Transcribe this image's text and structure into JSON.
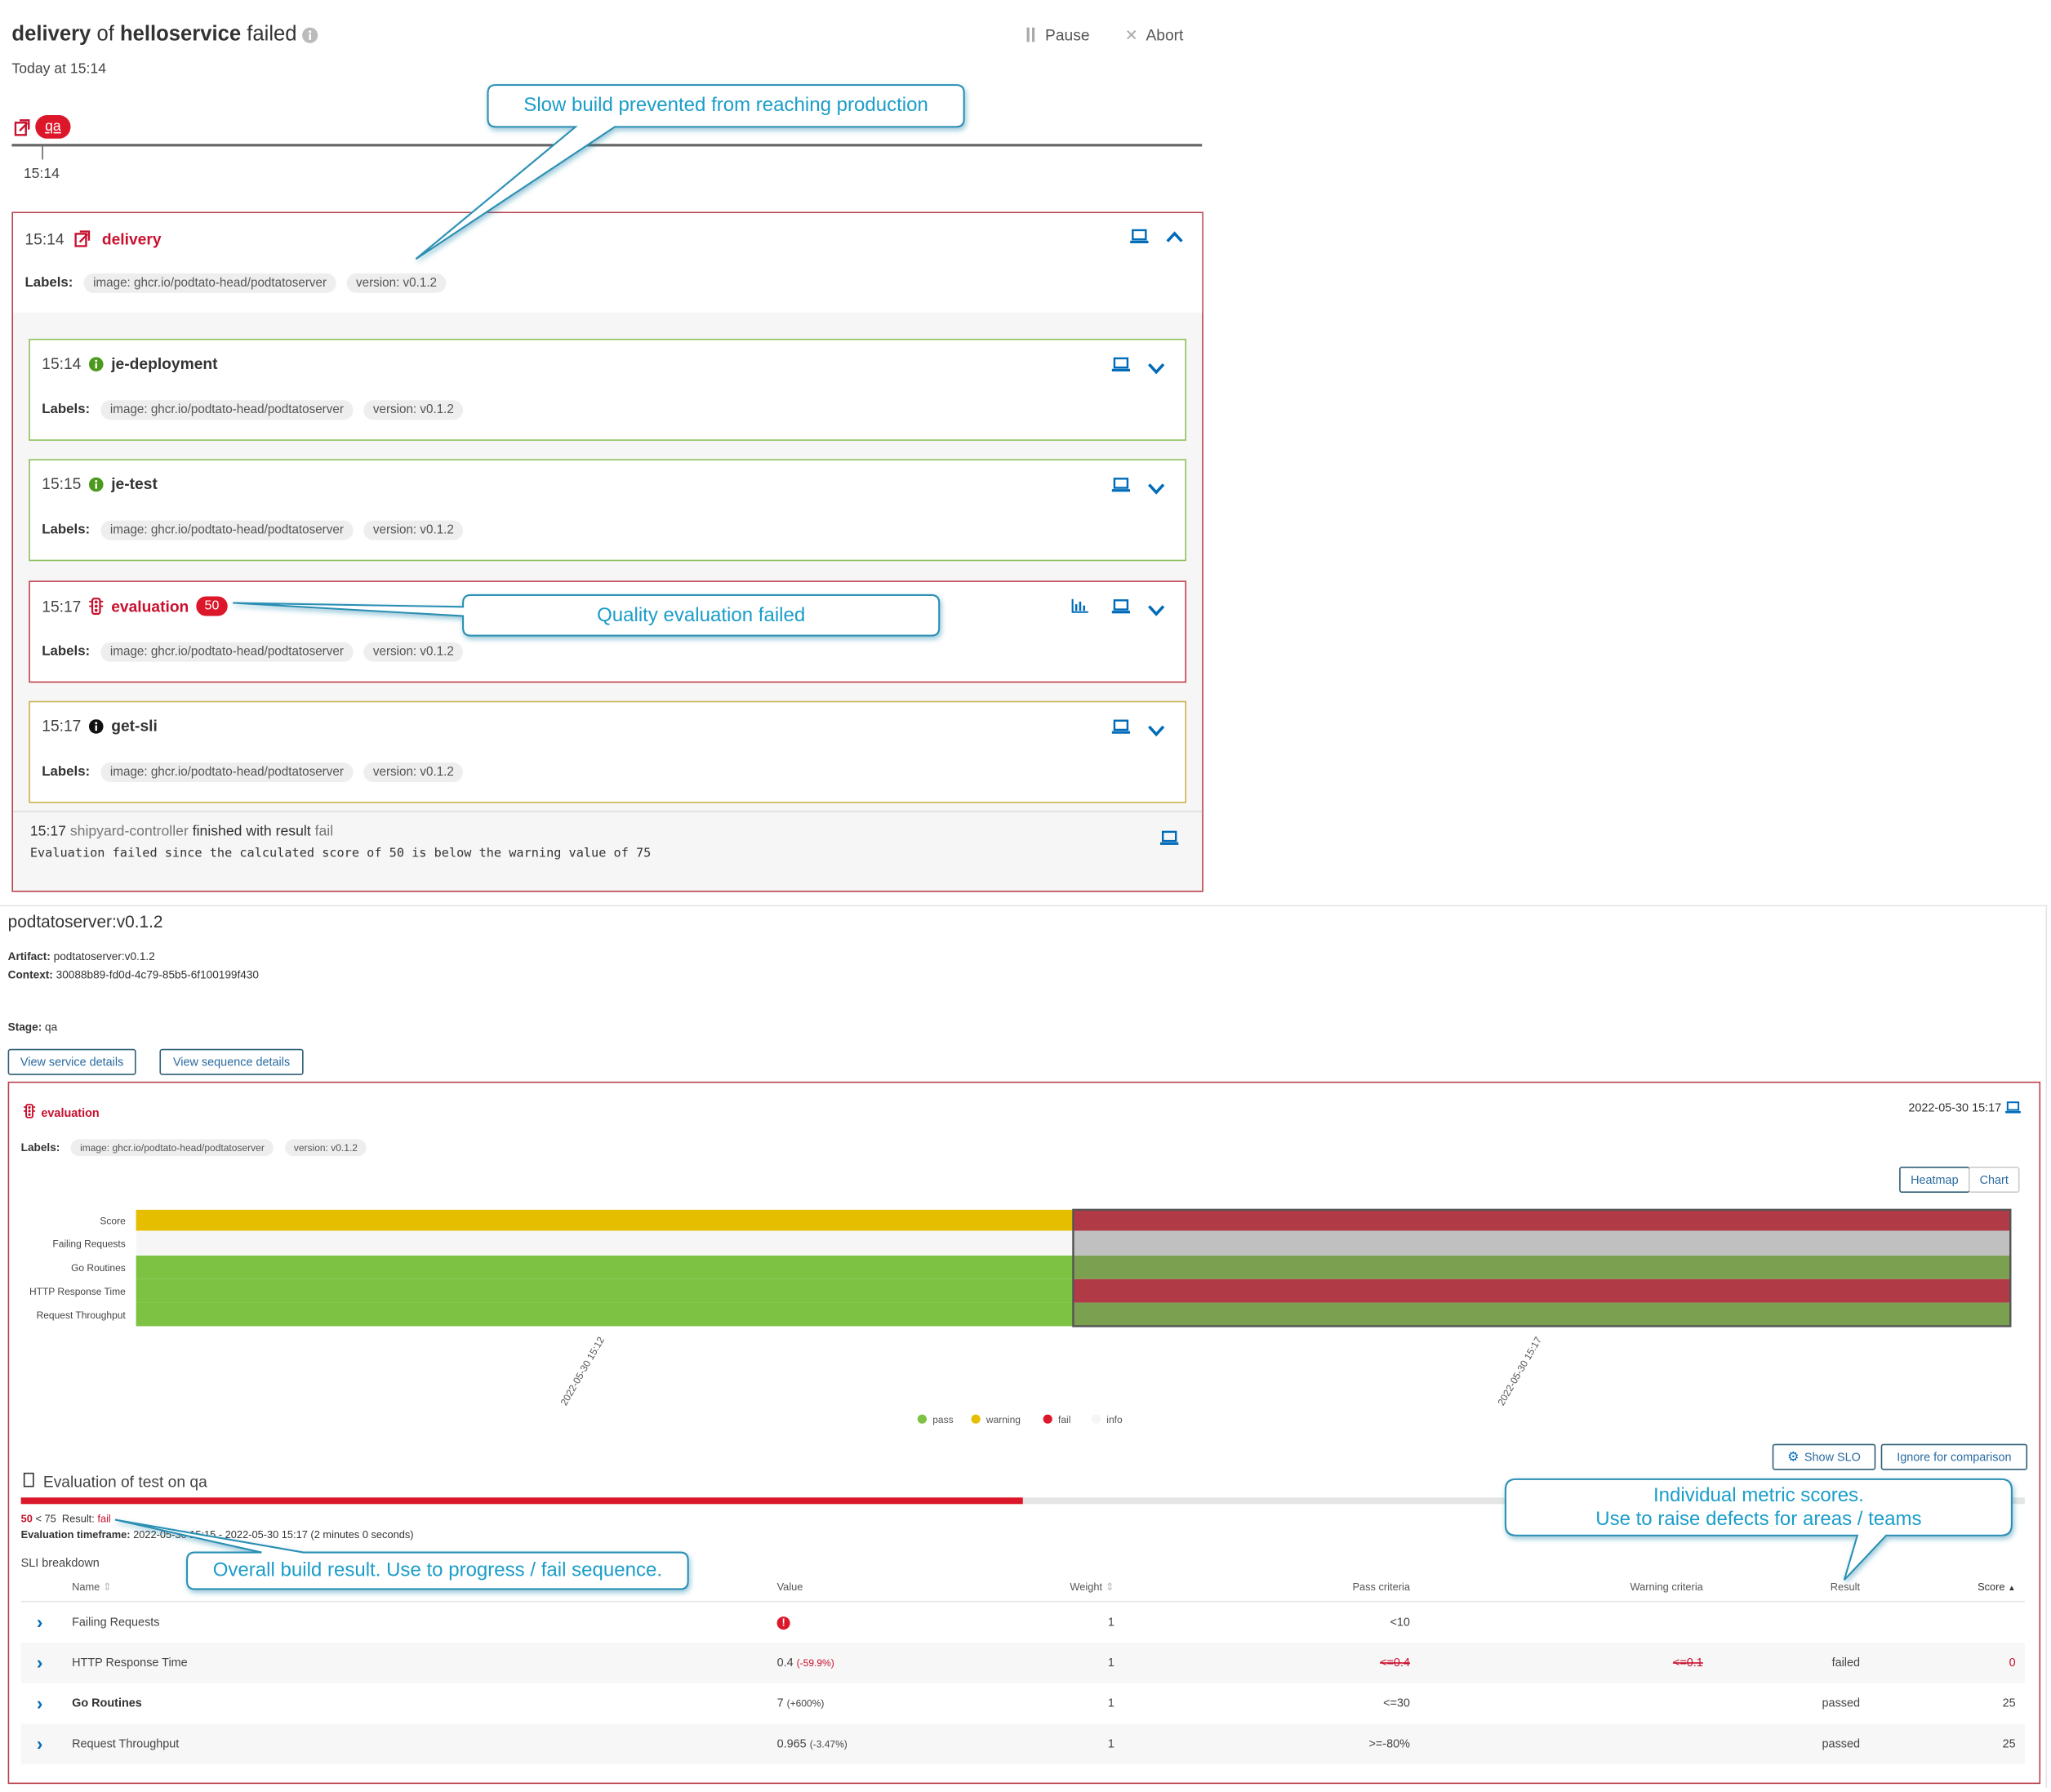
{
  "header": {
    "title_sequence": "delivery",
    "title_of": "of",
    "title_service": "helloservice",
    "title_status": "failed",
    "subtitle": "Today at 15:14",
    "pause_label": "Pause",
    "abort_label": "Abort"
  },
  "timeline": {
    "stage_badge": "qa",
    "tick_time": "15:14"
  },
  "delivery_card": {
    "time": "15:14",
    "name": "delivery",
    "labels_label": "Labels:",
    "labels": [
      "image: ghcr.io/podtato-head/podtatoserver",
      "version: v0.1.2"
    ],
    "tasks": [
      {
        "time": "15:14",
        "name": "je-deployment",
        "status": "success",
        "border": "#8dbf5a"
      },
      {
        "time": "15:15",
        "name": "je-test",
        "status": "success",
        "border": "#8dbf5a"
      },
      {
        "time": "15:17",
        "name": "evaluation",
        "status": "fail",
        "score": "50",
        "border": "#c2404c"
      },
      {
        "time": "15:17",
        "name": "get-sli",
        "status": "info",
        "border": "#c9b14a"
      }
    ],
    "footer": {
      "time": "15:17",
      "source": "shipyard-controller",
      "text": "finished with result",
      "result": "fail",
      "message": "Evaluation failed since the calculated score of 50 is below the warning value of 75"
    }
  },
  "callouts": {
    "slow_build": "Slow build prevented from reaching production",
    "quality": "Quality evaluation failed",
    "metric_scores_1": "Individual metric scores.",
    "metric_scores_2": "Use to raise defects for areas / teams",
    "overall": "Overall build result. Use to progress / fail sequence."
  },
  "details": {
    "title": "podtatoserver:v0.1.2",
    "artifact_label": "Artifact:",
    "artifact": "podtatoserver:v0.1.2",
    "context_label": "Context:",
    "context": "30088b89-fd0d-4c79-85b5-6f100199f430",
    "stage_label": "Stage:",
    "stage": "qa",
    "view_service": "View service details",
    "view_sequence": "View sequence details"
  },
  "evaluation": {
    "name": "evaluation",
    "date": "2022-05-30 15:17",
    "labels_label": "Labels:",
    "labels": [
      "image: ghcr.io/podtato-head/podtatoserver",
      "version: v0.1.2"
    ],
    "toggle": {
      "heatmap": "Heatmap",
      "chart": "Chart",
      "selected": "Heatmap"
    },
    "show_slo": "Show SLO",
    "ignore": "Ignore for comparison",
    "summary_title": "Evaluation of test on qa",
    "score": "50",
    "score_percent": 50,
    "threshold_text": "< 75",
    "result_label": "Result:",
    "result": "fail",
    "timeframe_label": "Evaluation timeframe:",
    "timeframe": "2022-05-30 15:15 - 2022-05-30 15:17 (2 minutes 0 seconds)",
    "sli_title": "SLI breakdown",
    "columns": [
      "Name",
      "Value",
      "Weight",
      "Pass criteria",
      "Warning criteria",
      "Result",
      "Score"
    ],
    "rows": [
      {
        "name": "Failing Requests",
        "value": "",
        "value_icon": "error-icon",
        "change": "",
        "weight": "1",
        "pass": "<10",
        "warning": "",
        "result": "",
        "score": "",
        "bold": false
      },
      {
        "name": "HTTP Response Time",
        "value": "0.4",
        "change": "(-59.9%)",
        "weight": "1",
        "pass": "<=0.4",
        "warning": "<=0.1",
        "result": "failed",
        "score": "0",
        "bold": false
      },
      {
        "name": "Go Routines",
        "value": "7",
        "change": "(+600%)",
        "weight": "1",
        "pass": "<=30",
        "warning": "",
        "result": "passed",
        "score": "25",
        "bold": true
      },
      {
        "name": "Request Throughput",
        "value": "0.965",
        "change": "(-3.47%)",
        "weight": "1",
        "pass": ">=-80%",
        "warning": "",
        "result": "passed",
        "score": "25",
        "bold": false
      }
    ]
  },
  "chart_data": {
    "type": "heatmap",
    "x": [
      "2022-05-30 15:12",
      "2022-05-30 15:17"
    ],
    "y": [
      "Score",
      "Failing Requests",
      "Go Routines",
      "HTTP Response Time",
      "Request Throughput"
    ],
    "values": [
      [
        "warning",
        "fail"
      ],
      [
        "info",
        "info"
      ],
      [
        "pass",
        "pass"
      ],
      [
        "pass",
        "fail"
      ],
      [
        "pass",
        "pass"
      ]
    ],
    "selected_x": "2022-05-30 15:17",
    "legend": [
      "pass",
      "warning",
      "fail",
      "info"
    ],
    "legend_placement": "bottom",
    "colors": {
      "pass": "#7dc242",
      "warning": "#e6be00",
      "fail": "#dc172a",
      "info": "#f5f5f5"
    }
  },
  "colors": {
    "fail": "#c8102e",
    "accent": "#006bb8",
    "success": "#4b9a1e"
  }
}
